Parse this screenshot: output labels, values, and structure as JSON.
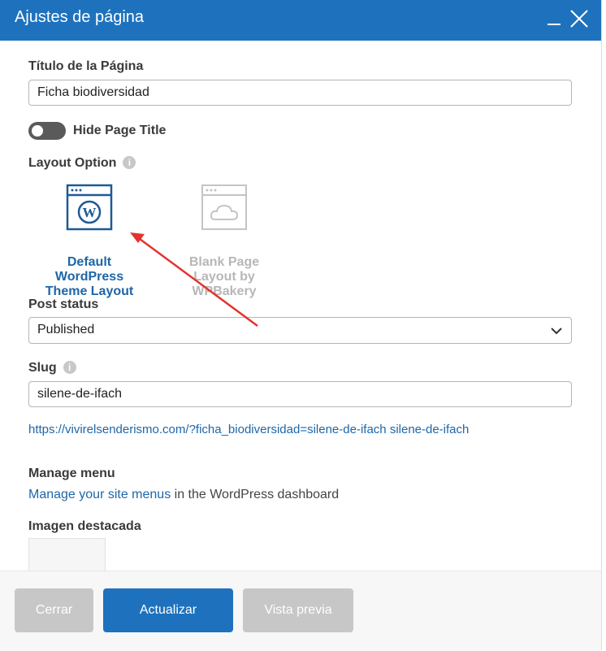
{
  "dialog": {
    "title": "Ajustes de página",
    "minimize_icon": "minus-icon",
    "close_icon": "close-icon"
  },
  "form": {
    "page_title_label": "Título de la Página",
    "page_title_value": "Ficha biodiversidad",
    "hide_title_label": "Hide Page Title",
    "hide_title_checked": false,
    "layout_label": "Layout Option",
    "layout_options": [
      {
        "label": "Default WordPress Theme Layout",
        "selected": true,
        "icon": "wordpress-window-icon"
      },
      {
        "label": "Blank Page Layout by WPBakery",
        "selected": false,
        "icon": "cloud-window-icon"
      }
    ],
    "post_status_label": "Post status",
    "post_status_value": "Published",
    "slug_label": "Slug",
    "slug_value": "silene-de-ifach",
    "permalink": "https://vivirelsenderismo.com/?ficha_biodiversidad=silene-de-ifach",
    "permalink_slug": "silene-de-ifach",
    "manage_menu_label": "Manage menu",
    "manage_menu_link": "Manage your site menus",
    "manage_menu_suffix": " in the WordPress dashboard",
    "featured_image_label": "Imagen destacada"
  },
  "footer": {
    "close_label": "Cerrar",
    "update_label": "Actualizar",
    "preview_label": "Vista previa"
  },
  "colors": {
    "header": "#1e72bd",
    "accent": "#1e66a8",
    "annotation_arrow": "#e5322d"
  }
}
